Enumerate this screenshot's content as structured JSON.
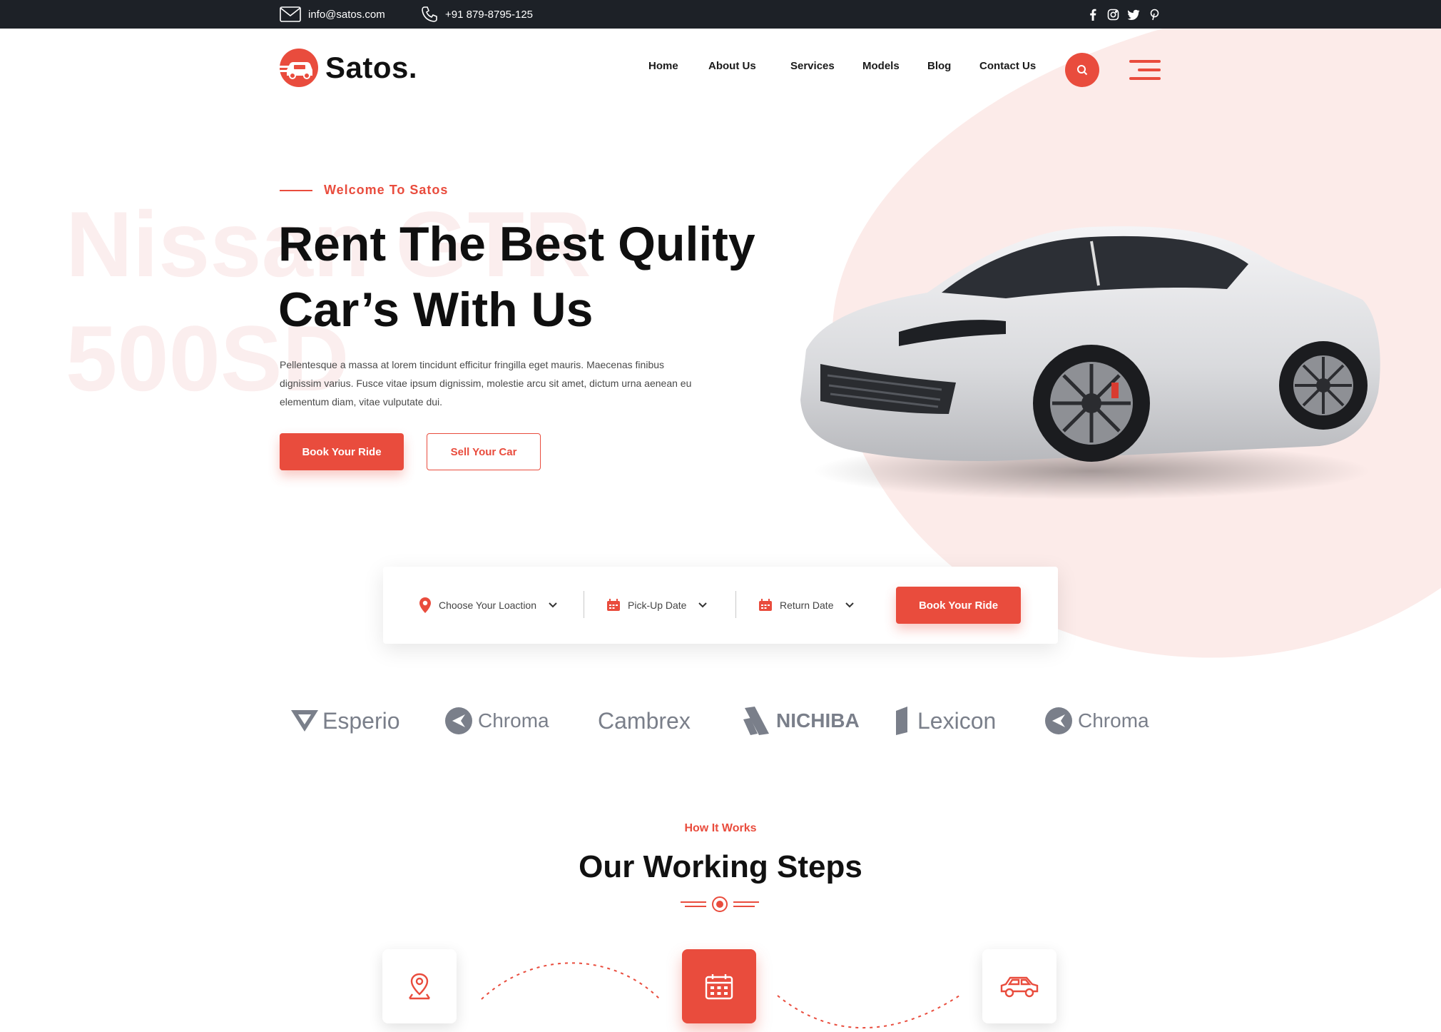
{
  "topbar": {
    "email": "info@satos.com",
    "phone": "+91 879-8795-125",
    "social_icons": [
      "facebook-icon",
      "instagram-icon",
      "twitter-icon",
      "pinterest-icon"
    ]
  },
  "brand": {
    "name": "Satos."
  },
  "nav": {
    "items": [
      "Home",
      "About Us",
      "Services",
      "Models",
      "Blog",
      "Contact Us"
    ]
  },
  "hero": {
    "kicker": "Welcome To Satos",
    "background_text": "Nissan GTR\n500SD",
    "headline_line1": "Rent The Best Qulity",
    "headline_line2": "Car’s With Us",
    "description": "Pellentesque a massa at lorem tincidunt efficitur fringilla eget mauris. Maecenas finibus dignissim varius. Fusce vitae ipsum dignissim, molestie arcu sit amet, dictum urna aenean eu elementum diam, vitae vulputate dui.",
    "primary_button": "Book Your Ride",
    "secondary_button": "Sell Your Car"
  },
  "booking": {
    "location_placeholder": "Choose Your Loaction",
    "pickup_placeholder": "Pick-Up Date",
    "return_placeholder": "Return Date",
    "submit_button": "Book Your Ride"
  },
  "partners": [
    "Esperio",
    "Chroma",
    "Cambrex",
    "NICHIBA",
    "Lexicon",
    "Chroma"
  ],
  "working_steps": {
    "subtitle": "How It Works",
    "title": "Our Working Steps",
    "steps": [
      "location-pin-icon",
      "calendar-icon",
      "car-icon"
    ]
  },
  "colors": {
    "accent": "#e94c3d",
    "dark_bar": "#1d2127",
    "blob": "#fcebe9"
  }
}
